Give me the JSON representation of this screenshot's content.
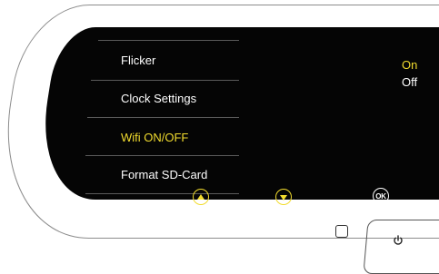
{
  "menu": {
    "items": [
      {
        "label": "Flicker",
        "selected": false
      },
      {
        "label": "Clock Settings",
        "selected": false
      },
      {
        "label": "Wifi ON/OFF",
        "selected": true
      },
      {
        "label": "Format SD-Card",
        "selected": false
      }
    ]
  },
  "options": {
    "items": [
      {
        "label": "On",
        "selected": true
      },
      {
        "label": "Off",
        "selected": false
      }
    ]
  },
  "buttons": {
    "ok_label": "OK"
  },
  "icons": {
    "up": "up-arrow-icon",
    "down": "down-arrow-icon",
    "ok": "ok-icon",
    "power": "power-icon"
  },
  "colors": {
    "selected": "#f2dc2e",
    "text": "#ffffff",
    "screen": "#050505"
  }
}
